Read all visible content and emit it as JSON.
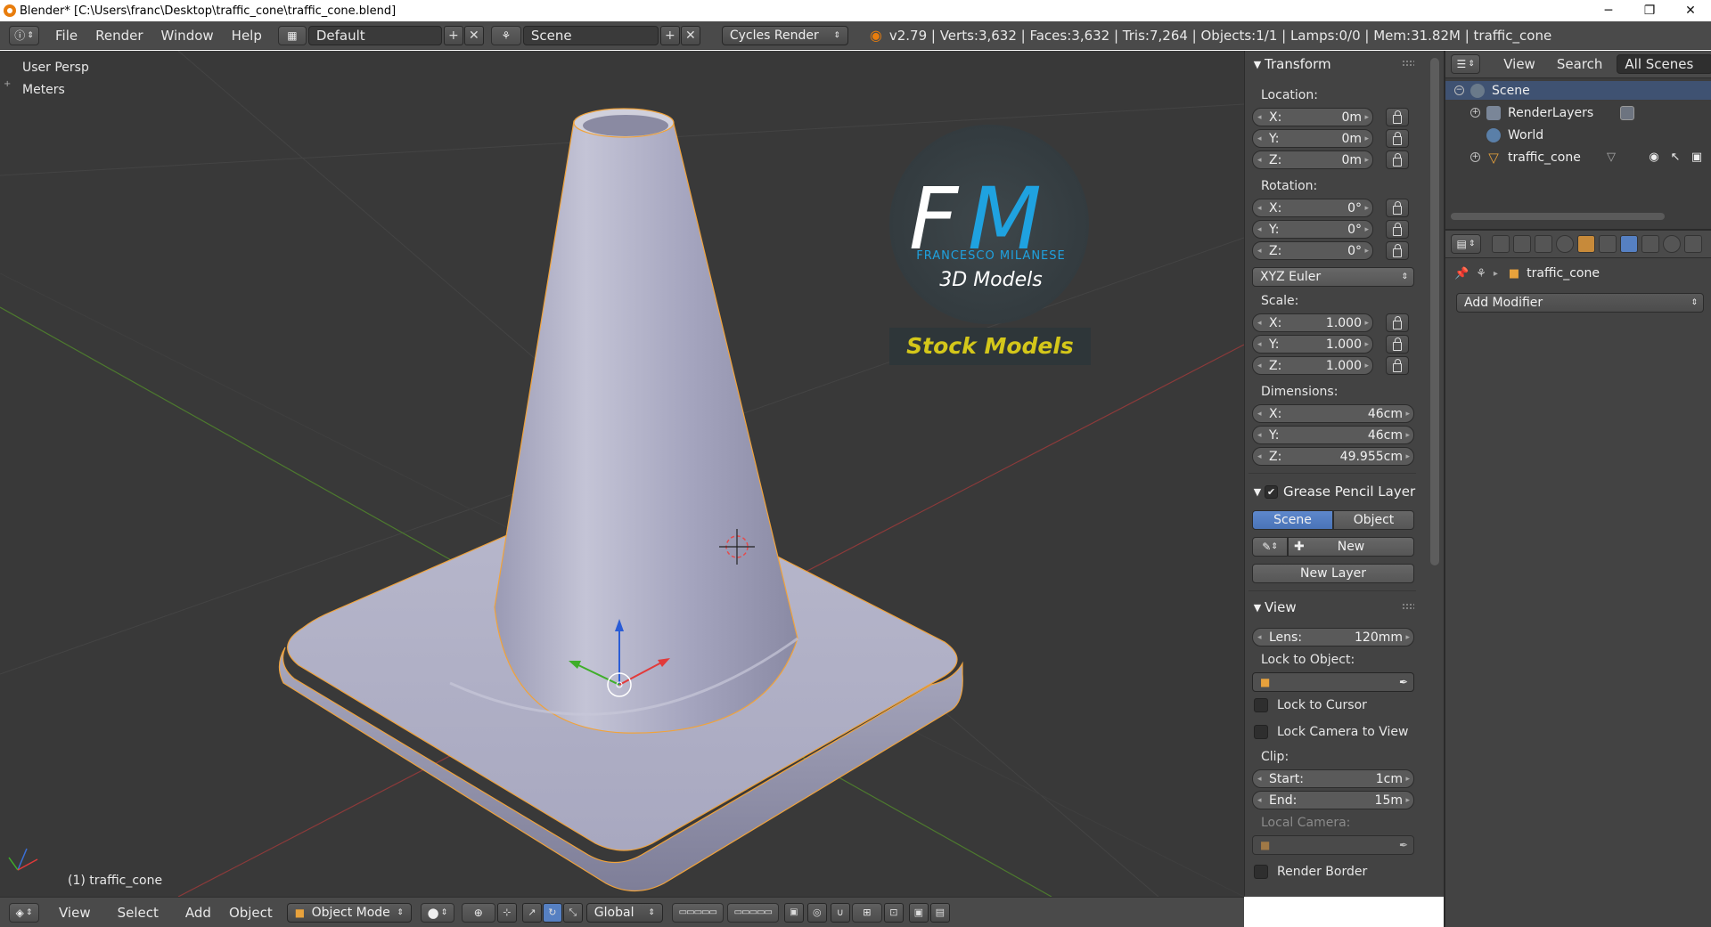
{
  "titlebar": {
    "title": "Blender* [C:\\Users\\franc\\Desktop\\traffic_cone\\traffic_cone.blend]",
    "minimize": "─",
    "maximize": "❐",
    "close": "✕"
  },
  "info_header": {
    "menus": [
      "File",
      "Render",
      "Window",
      "Help"
    ],
    "layout": "Default",
    "scene": "Scene",
    "engine": "Cycles Render",
    "stats": "v2.79 | Verts:3,632 | Faces:3,632 | Tris:7,264 | Objects:1/1 | Lamps:0/0 | Mem:31.82M | traffic_cone"
  },
  "viewport": {
    "view_name": "User Persp",
    "units": "Meters",
    "object_label": "(1) traffic_cone",
    "logo_initials": "FM",
    "logo_name": "FRANCESCO MILANESE",
    "logo_subtitle": "3D Models",
    "logo_banner": "Stock Models",
    "colors": {
      "background": "#393939",
      "x_axis": "#8c3a3a",
      "y_axis": "#4d7a2e",
      "selection_outline": "#f0a33c",
      "cone": "#a6a6c0"
    }
  },
  "viewport_header": {
    "menus": [
      "View",
      "Select",
      "Add",
      "Object"
    ],
    "mode": "Object Mode",
    "orientation": "Global"
  },
  "npanel": {
    "transform": {
      "title": "Transform",
      "location_label": "Location:",
      "location": [
        {
          "axis": "X:",
          "value": "0m"
        },
        {
          "axis": "Y:",
          "value": "0m"
        },
        {
          "axis": "Z:",
          "value": "0m"
        }
      ],
      "rotation_label": "Rotation:",
      "rotation": [
        {
          "axis": "X:",
          "value": "0°"
        },
        {
          "axis": "Y:",
          "value": "0°"
        },
        {
          "axis": "Z:",
          "value": "0°"
        }
      ],
      "rotation_mode": "XYZ Euler",
      "scale_label": "Scale:",
      "scale": [
        {
          "axis": "X:",
          "value": "1.000"
        },
        {
          "axis": "Y:",
          "value": "1.000"
        },
        {
          "axis": "Z:",
          "value": "1.000"
        }
      ],
      "dimensions_label": "Dimensions:",
      "dimensions": [
        {
          "axis": "X:",
          "value": "46cm"
        },
        {
          "axis": "Y:",
          "value": "46cm"
        },
        {
          "axis": "Z:",
          "value": "49.955cm"
        }
      ]
    },
    "grease_pencil": {
      "title": "Grease Pencil Layer",
      "tab_scene": "Scene",
      "tab_object": "Object",
      "new_label": "New",
      "new_layer_label": "New Layer"
    },
    "view": {
      "title": "View",
      "lens_label": "Lens:",
      "lens_value": "120mm",
      "lock_object_label": "Lock to Object:",
      "lock_cursor_label": "Lock to Cursor",
      "lock_camera_label": "Lock Camera to View",
      "clip_label": "Clip:",
      "clip_start_label": "Start:",
      "clip_start_value": "1cm",
      "clip_end_label": "End:",
      "clip_end_value": "15m",
      "local_camera_label": "Local Camera:",
      "render_border_label": "Render Border"
    }
  },
  "outliner": {
    "menu_view": "View",
    "menu_search": "Search",
    "filter": "All Scenes",
    "items": [
      {
        "name": "Scene",
        "icon": "scene-icon"
      },
      {
        "name": "RenderLayers",
        "icon": "render-layers-icon"
      },
      {
        "name": "World",
        "icon": "world-icon"
      },
      {
        "name": "traffic_cone",
        "icon": "mesh-object-icon"
      }
    ]
  },
  "properties": {
    "breadcrumb_object": "traffic_cone",
    "add_modifier_label": "Add Modifier"
  }
}
